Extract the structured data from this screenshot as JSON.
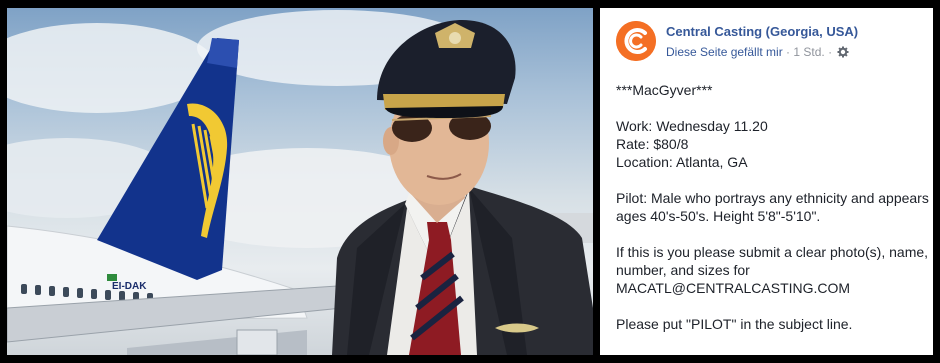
{
  "post": {
    "page_name": "Central Casting (Georgia, USA)",
    "like_status": "Diese Seite gefällt mir",
    "separator": " · ",
    "time": "1 Std.",
    "separator2": " · ",
    "icons": {
      "avatar": "central-casting-logo",
      "privacy": "gear-icon"
    },
    "lines": {
      "title": "***MacGyver***",
      "work": "Work: Wednesday 11.20",
      "rate": "Rate: $80/8",
      "location": "Location: Atlanta, GA",
      "role": "Pilot: Male who portrays any ethnicity and appears ages 40's-50's. Height 5'8\"-5'10\".",
      "submit": "If this is you please submit a clear photo(s), name, number, and sizes for",
      "email": "MACATL@CENTRALCASTING.COM",
      "subject": "Please put \"PILOT\" in the subject line."
    }
  },
  "photo": {
    "aircraft_registration": "EI-DAK"
  },
  "colors": {
    "link": "#365899",
    "brand_orange": "#f46f24",
    "text": "#1d2129",
    "meta": "#90949c",
    "tail_blue": "#12338c",
    "harp_yellow": "#f1c933"
  }
}
